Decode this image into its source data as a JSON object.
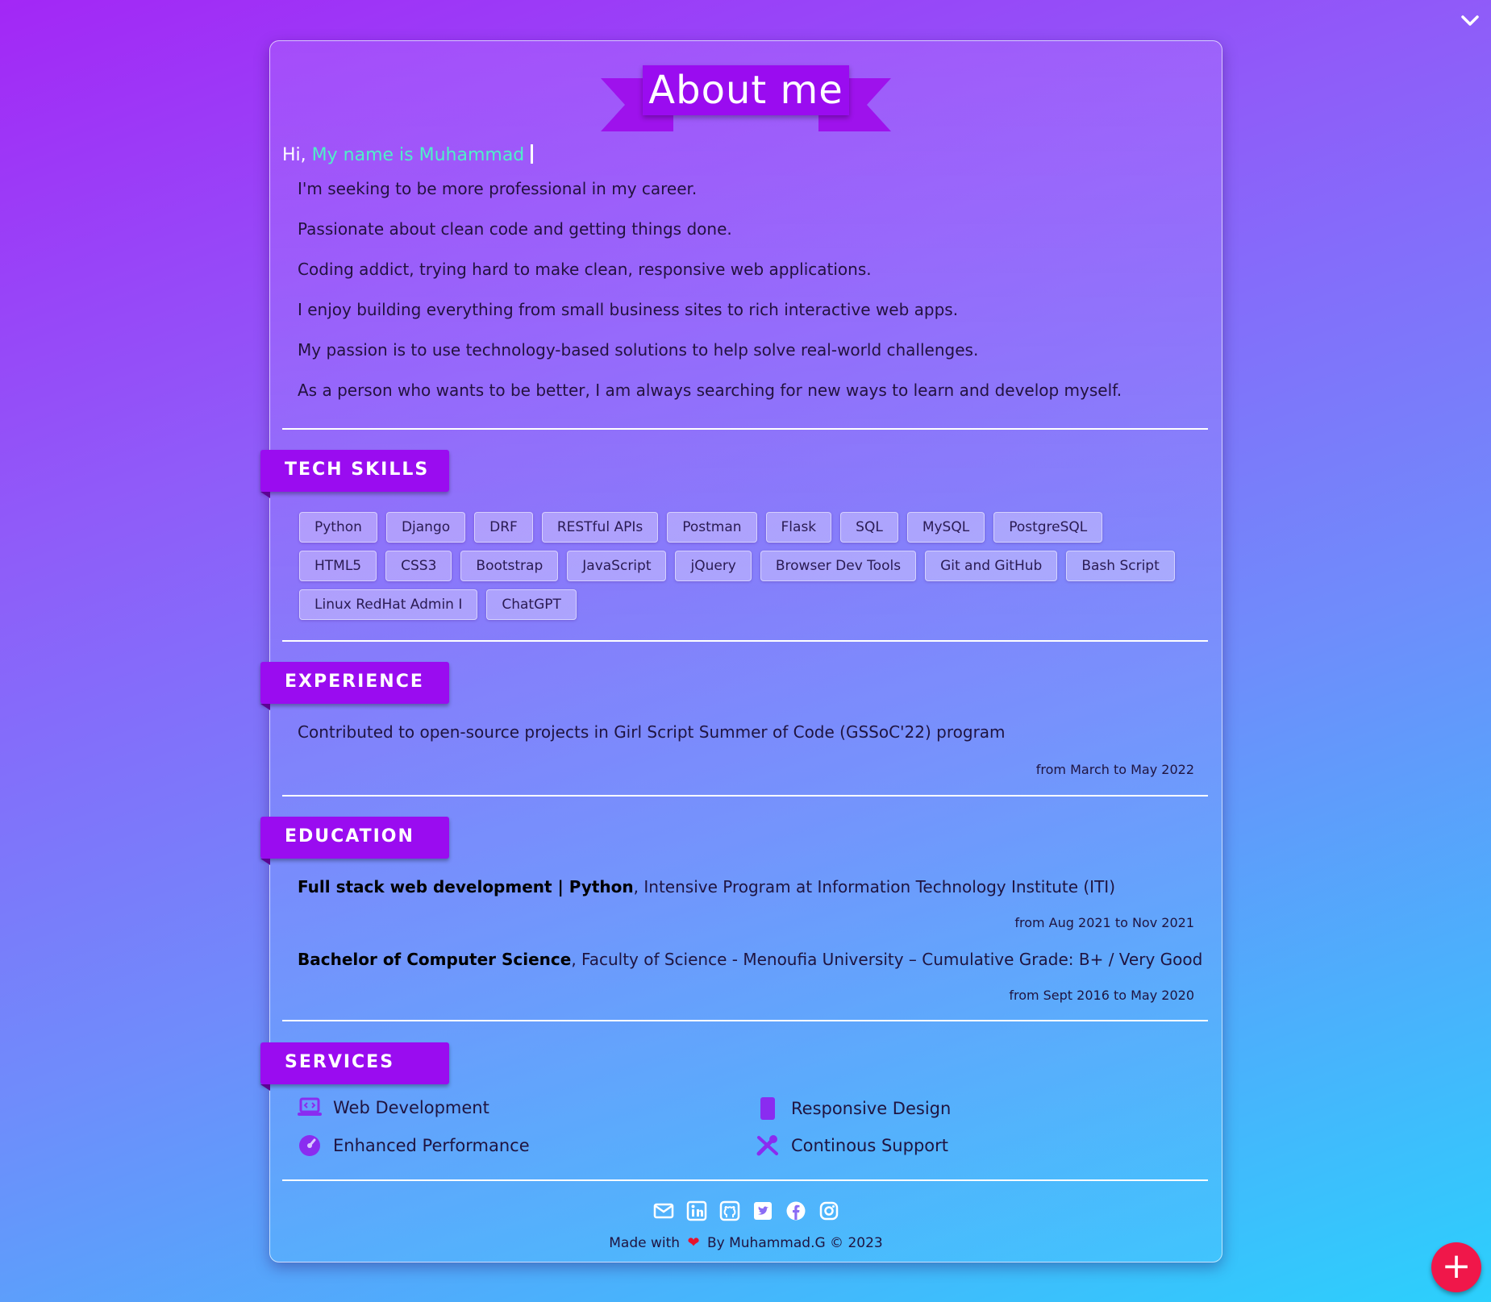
{
  "header": {
    "title": "About me"
  },
  "intro": {
    "hi": "Hi,",
    "typed_name": "My name is Muhammad",
    "lines": [
      "I'm seeking to be more professional in my career.",
      "Passionate about clean code and getting things done.",
      "Coding addict, trying hard to make clean, responsive web applications.",
      "I enjoy building everything from small business sites to rich interactive web apps.",
      "My passion is to use technology-based solutions to help solve real-world challenges.",
      "As a person who wants to be better, I am always searching for new ways to learn and develop myself."
    ]
  },
  "skills": {
    "heading": "TECH SKILLS",
    "items": [
      "Python",
      "Django",
      "DRF",
      "RESTful APIs",
      "Postman",
      "Flask",
      "SQL",
      "MySQL",
      "PostgreSQL",
      "HTML5",
      "CSS3",
      "Bootstrap",
      "JavaScript",
      "jQuery",
      "Browser Dev Tools",
      "Git and GitHub",
      "Bash Script",
      "Linux RedHat Admin I",
      "ChatGPT"
    ]
  },
  "experience": {
    "heading": "EXPERIENCE",
    "items": [
      {
        "text": "Contributed to open-source projects in Girl Script Summer of Code (GSSoC'22) program",
        "date": "from March to May 2022"
      }
    ]
  },
  "education": {
    "heading": "EDUCATION",
    "items": [
      {
        "title": "Full stack web development | Python",
        "rest": ", Intensive Program at Information Technology Institute (ITI)",
        "date": "from Aug 2021 to Nov 2021"
      },
      {
        "title": "Bachelor of Computer Science",
        "rest": ", Faculty of Science - Menoufia University – Cumulative Grade: B+ / Very Good",
        "date": "from Sept 2016 to May 2020"
      }
    ]
  },
  "services": {
    "heading": "SERVICES",
    "items": [
      {
        "label": "Web Development",
        "icon": "laptop-code-icon"
      },
      {
        "label": "Responsive Design",
        "icon": "mobile-icon"
      },
      {
        "label": "Enhanced Performance",
        "icon": "gauge-icon"
      },
      {
        "label": "Continous Support",
        "icon": "tools-icon"
      }
    ]
  },
  "footer": {
    "made_with": "Made with",
    "by": "By Muhammad.G © 2023",
    "socials": [
      "envelope-icon",
      "linkedin-icon",
      "github-icon",
      "twitter-icon",
      "facebook-icon",
      "instagram-icon"
    ]
  },
  "colors": {
    "accent": "#9a0cf0",
    "name_highlight": "#4ff0c8",
    "fab": "#f0174a"
  }
}
